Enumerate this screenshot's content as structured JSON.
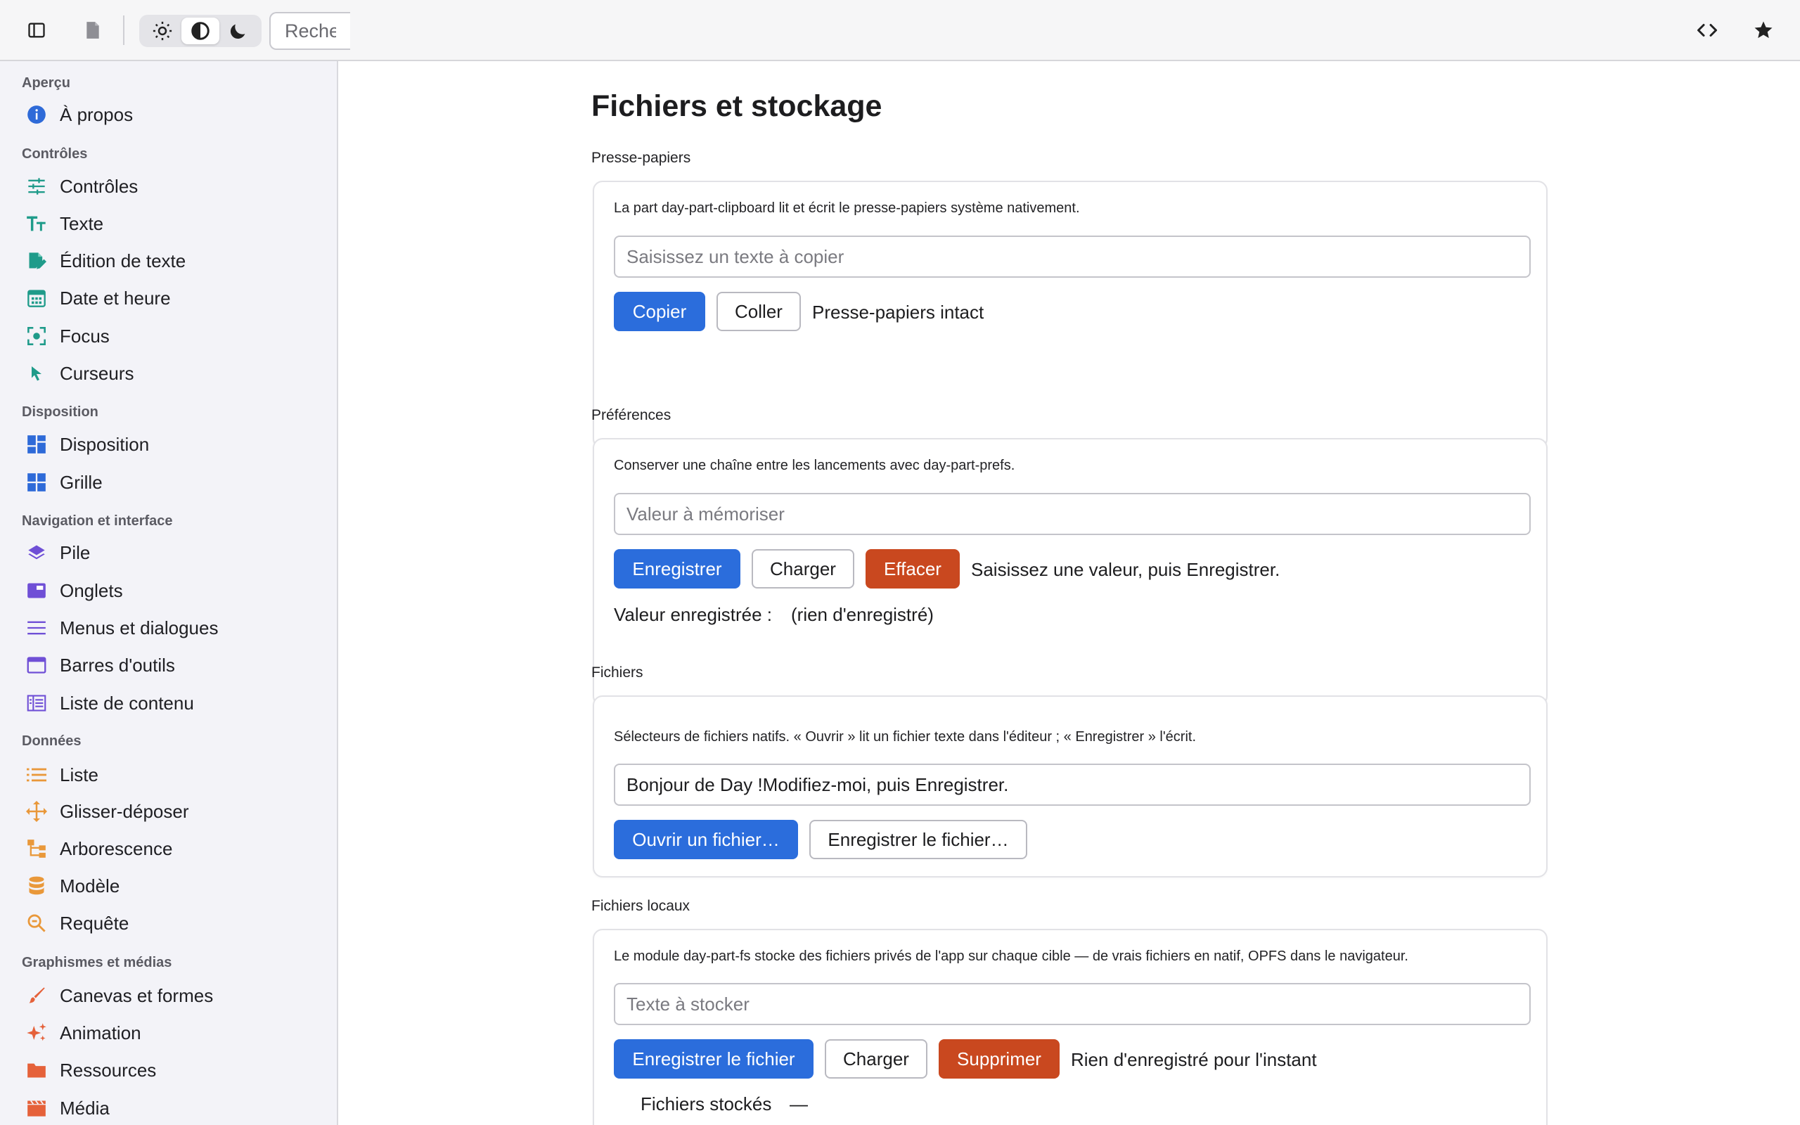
{
  "toolbar": {
    "search_placeholder": "Recherc",
    "icons": [
      "sidebar-toggle-icon",
      "document-icon",
      "sun-icon",
      "contrast-icon",
      "moon-icon",
      "code-icon",
      "star-icon"
    ]
  },
  "sidebar": {
    "sections": [
      {
        "title": "Aperçu",
        "items": [
          {
            "label": "À propos",
            "icon": "info-icon"
          }
        ]
      },
      {
        "title": "Contrôles",
        "items": [
          {
            "label": "Contrôles",
            "icon": "sliders-icon"
          },
          {
            "label": "Texte",
            "icon": "text-size-icon"
          },
          {
            "label": "Édition de texte",
            "icon": "edit-document-icon"
          },
          {
            "label": "Date et heure",
            "icon": "calendar-icon"
          },
          {
            "label": "Focus",
            "icon": "focus-icon"
          },
          {
            "label": "Curseurs",
            "icon": "cursor-icon"
          }
        ]
      },
      {
        "title": "Disposition",
        "items": [
          {
            "label": "Disposition",
            "icon": "dashboard-icon"
          },
          {
            "label": "Grille",
            "icon": "grid-icon"
          }
        ]
      },
      {
        "title": "Navigation et interface",
        "items": [
          {
            "label": "Pile",
            "icon": "layers-icon"
          },
          {
            "label": "Onglets",
            "icon": "tabs-icon"
          },
          {
            "label": "Menus et dialogues",
            "icon": "menu-lines-icon"
          },
          {
            "label": "Barres d'outils",
            "icon": "toolbar-window-icon"
          },
          {
            "label": "Liste de contenu",
            "icon": "content-list-icon"
          }
        ]
      },
      {
        "title": "Données",
        "items": [
          {
            "label": "Liste",
            "icon": "list-icon"
          },
          {
            "label": "Glisser-déposer",
            "icon": "move-icon"
          },
          {
            "label": "Arborescence",
            "icon": "tree-icon"
          },
          {
            "label": "Modèle",
            "icon": "database-icon"
          },
          {
            "label": "Requête",
            "icon": "search-zoom-icon"
          }
        ]
      },
      {
        "title": "Graphismes et médias",
        "items": [
          {
            "label": "Canevas et formes",
            "icon": "brush-icon"
          },
          {
            "label": "Animation",
            "icon": "sparkle-icon"
          },
          {
            "label": "Ressources",
            "icon": "folder-icon"
          },
          {
            "label": "Média",
            "icon": "clapperboard-icon"
          }
        ]
      }
    ]
  },
  "main": {
    "title": "Fichiers et stockage",
    "clipboard": {
      "title": "Presse-papiers",
      "description": "La part day-part-clipboard lit et écrit le presse-papiers système nativement.",
      "placeholder": "Saisissez un texte à copier",
      "copy_label": "Copier",
      "paste_label": "Coller",
      "status": "Presse-papiers intact"
    },
    "prefs": {
      "title": "Préférences",
      "description": "Conserver une chaîne entre les lancements avec day-part-prefs.",
      "placeholder": "Valeur à mémoriser",
      "save_label": "Enregistrer",
      "load_label": "Charger",
      "clear_label": "Effacer",
      "status": "Saisissez une valeur, puis Enregistrer.",
      "saved_label": "Valeur enregistrée :",
      "saved_value": "(rien d'enregistré)"
    },
    "files": {
      "title": "Fichiers",
      "description": "Sélecteurs de fichiers natifs. « Ouvrir » lit un fichier texte dans l'éditeur ; « Enregistrer » l'écrit.",
      "value": "Bonjour de Day !Modifiez-moi, puis Enregistrer.",
      "open_label": "Ouvrir un fichier…",
      "save_label": "Enregistrer le fichier…"
    },
    "local_files": {
      "title": "Fichiers locaux",
      "description": "Le module day-part-fs stocke des fichiers privés de l'app sur chaque cible — de vrais fichiers en natif, OPFS dans le navigateur.",
      "placeholder": "Texte à stocker",
      "save_label": "Enregistrer le fichier",
      "load_label": "Charger",
      "delete_label": "Supprimer",
      "status": "Rien d'enregistré pour l'instant",
      "stored_label": "Fichiers stockés",
      "stored_value": "—"
    }
  }
}
